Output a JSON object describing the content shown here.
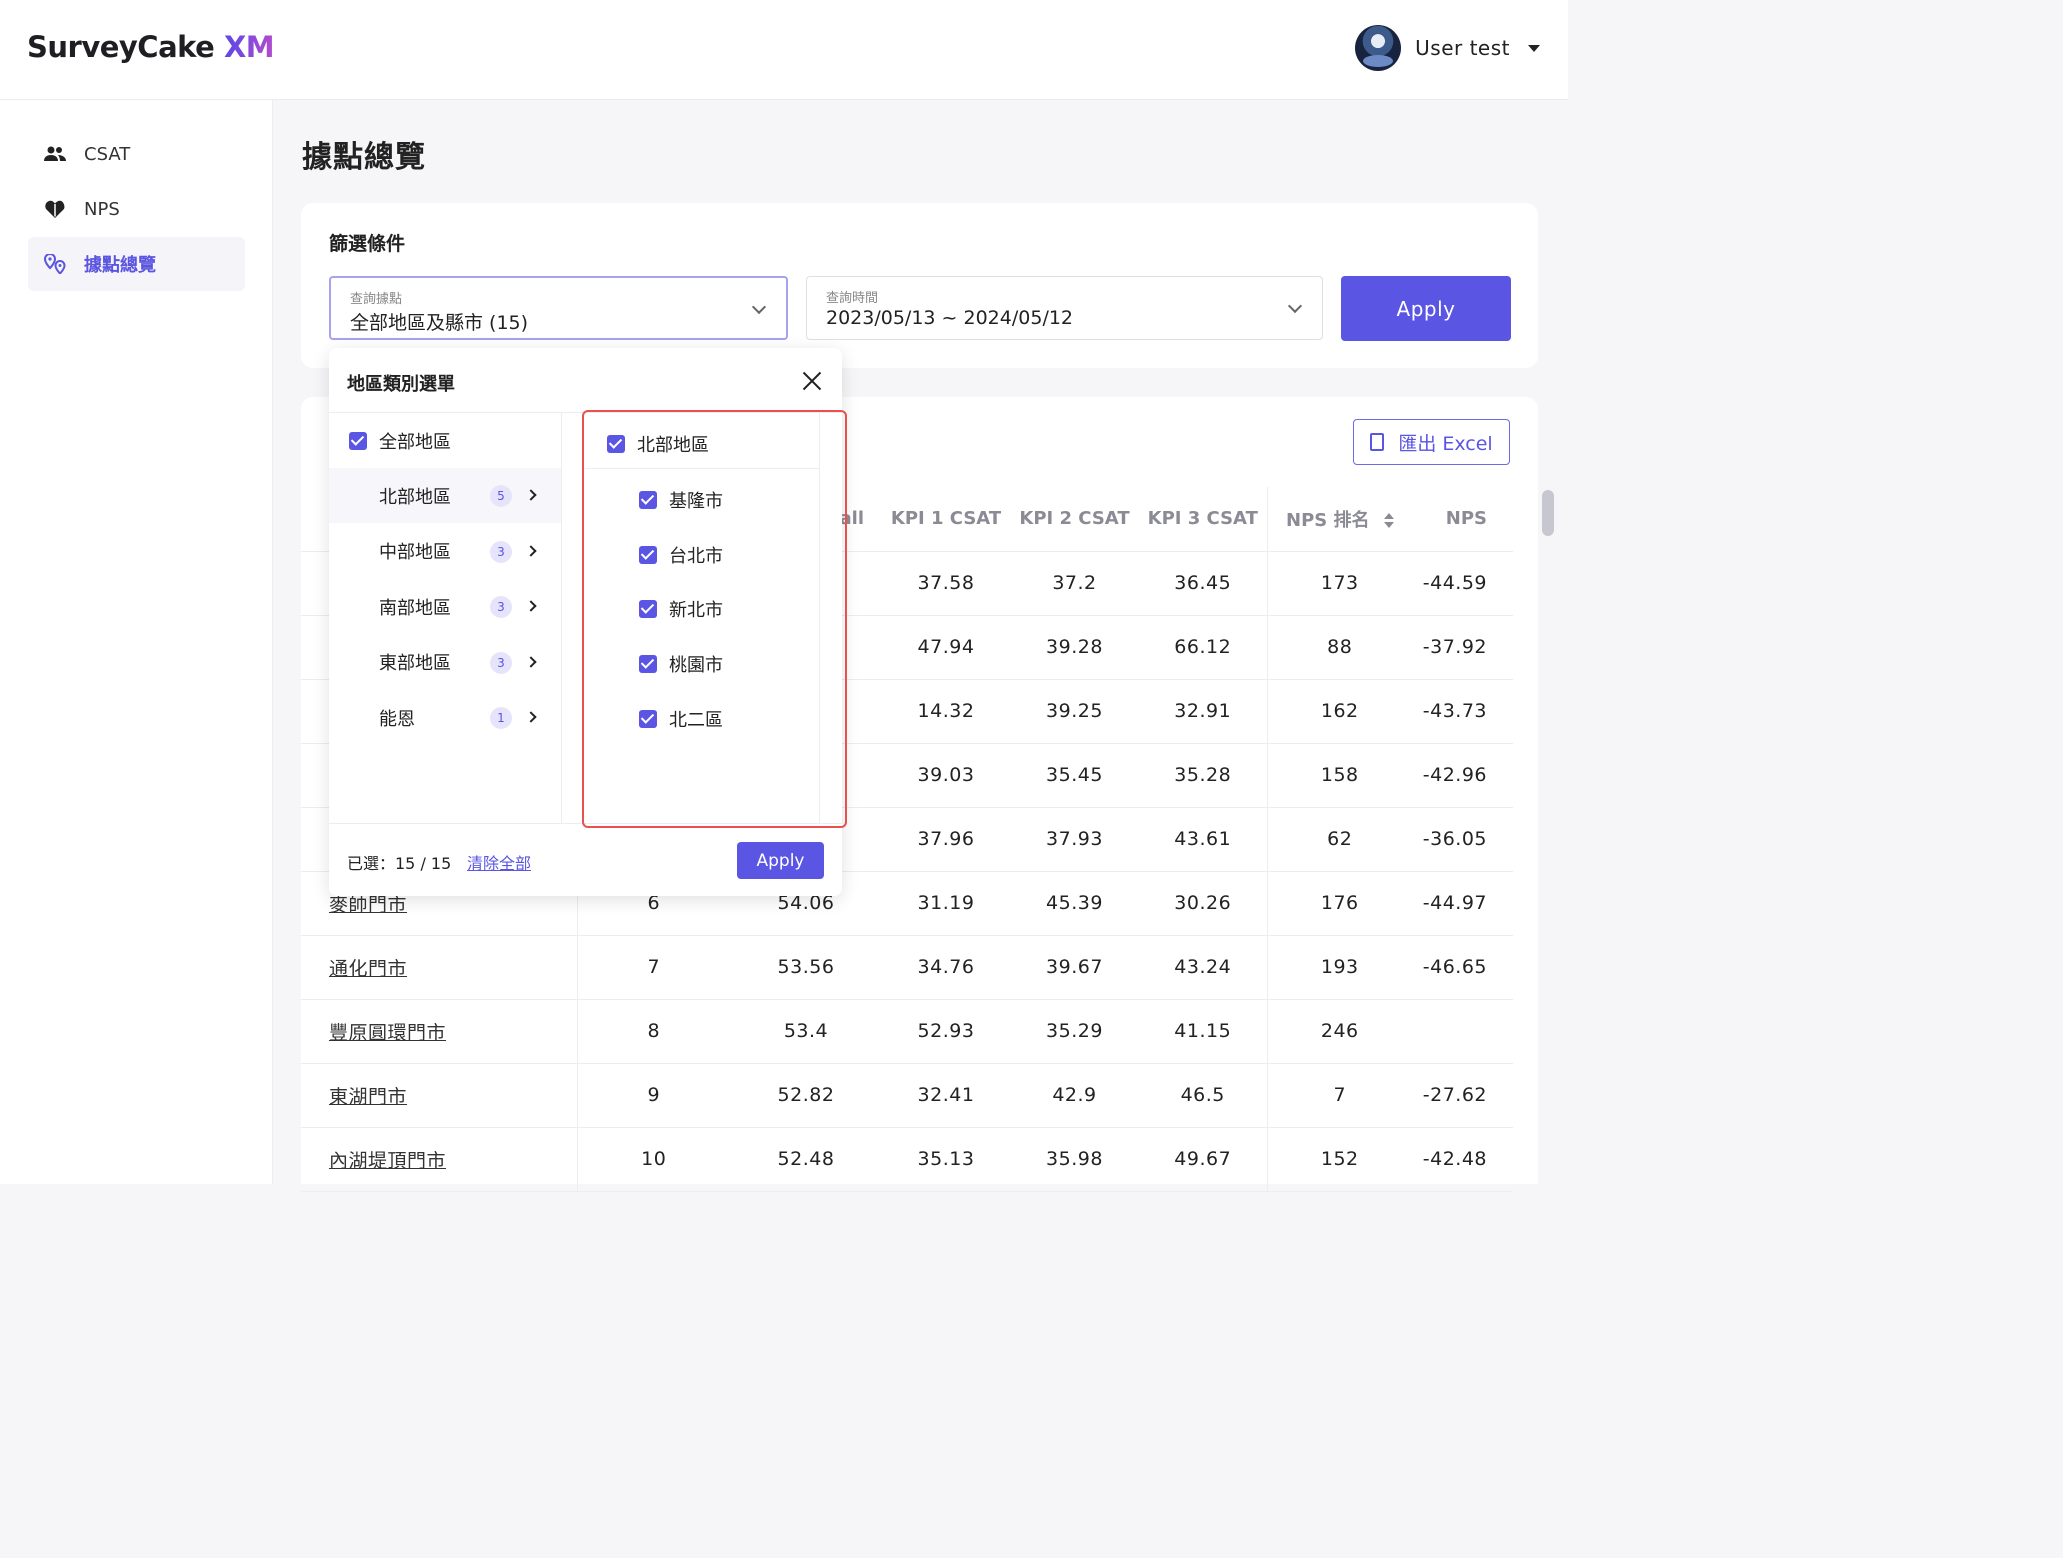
{
  "header": {
    "logo_main": "SurveyCake",
    "logo_xm": "XM",
    "user_name": "User test"
  },
  "sidebar": {
    "items": [
      {
        "label": "CSAT",
        "icon": "users-icon"
      },
      {
        "label": "NPS",
        "icon": "heart-icon"
      },
      {
        "label": "據點總覽",
        "icon": "location-pins-icon",
        "active": true
      }
    ]
  },
  "page": {
    "title": "據點總覽"
  },
  "filter": {
    "title": "篩選條件",
    "location": {
      "caption": "查詢據點",
      "value": "全部地區及縣市 (15)"
    },
    "date": {
      "caption": "查詢時間",
      "value": "2023/05/13 ~ 2024/05/12"
    },
    "apply_label": "Apply"
  },
  "export": {
    "label": "匯出 Excel"
  },
  "table": {
    "columns": {
      "partial": "all",
      "kpi1": "KPI 1 CSAT",
      "kpi2": "KPI 2 CSAT",
      "kpi3": "KPI 3 CSAT",
      "nps_rank": "NPS 排名",
      "nps": "NPS"
    },
    "rows": [
      {
        "name": "",
        "rank": "",
        "overall": "",
        "kpi1": "37.58",
        "kpi2": "37.2",
        "kpi3": "36.45",
        "nps_rank": "173",
        "nps": "-44.59"
      },
      {
        "name": "",
        "rank": "",
        "overall": "",
        "kpi1": "47.94",
        "kpi2": "39.28",
        "kpi3": "66.12",
        "nps_rank": "88",
        "nps": "-37.92"
      },
      {
        "name": "",
        "rank": "",
        "overall": "",
        "kpi1": "14.32",
        "kpi2": "39.25",
        "kpi3": "32.91",
        "nps_rank": "162",
        "nps": "-43.73"
      },
      {
        "name": "",
        "rank": "",
        "overall": "",
        "kpi1": "39.03",
        "kpi2": "35.45",
        "kpi3": "35.28",
        "nps_rank": "158",
        "nps": "-42.96"
      },
      {
        "name": "",
        "rank": "",
        "overall": "",
        "kpi1": "37.96",
        "kpi2": "37.93",
        "kpi3": "43.61",
        "nps_rank": "62",
        "nps": "-36.05"
      },
      {
        "name": "麥帥門市",
        "rank": "6",
        "overall": "54.06",
        "kpi1": "31.19",
        "kpi2": "45.39",
        "kpi3": "30.26",
        "nps_rank": "176",
        "nps": "-44.97"
      },
      {
        "name": "通化門市",
        "rank": "7",
        "overall": "53.56",
        "kpi1": "34.76",
        "kpi2": "39.67",
        "kpi3": "43.24",
        "nps_rank": "193",
        "nps": "-46.65"
      },
      {
        "name": "豐原圓環門市",
        "rank": "8",
        "overall": "53.4",
        "kpi1": "52.93",
        "kpi2": "35.29",
        "kpi3": "41.15",
        "nps_rank": "246",
        "nps": ""
      },
      {
        "name": "東湖門市",
        "rank": "9",
        "overall": "52.82",
        "kpi1": "32.41",
        "kpi2": "42.9",
        "kpi3": "46.5",
        "nps_rank": "7",
        "nps": "-27.62"
      },
      {
        "name": "內湖堤頂門市",
        "rank": "10",
        "overall": "52.48",
        "kpi1": "35.13",
        "kpi2": "35.98",
        "kpi3": "49.67",
        "nps_rank": "152",
        "nps": "-42.48"
      }
    ]
  },
  "dropdown": {
    "title": "地區類別選單",
    "all_label": "全部地區",
    "regions": [
      {
        "label": "北部地區",
        "count": "5"
      },
      {
        "label": "中部地區",
        "count": "3"
      },
      {
        "label": "南部地區",
        "count": "3"
      },
      {
        "label": "東部地區",
        "count": "3"
      },
      {
        "label": "能恩",
        "count": "1"
      }
    ],
    "selected_region": "北部地區",
    "cities": [
      "基隆市",
      "台北市",
      "新北市",
      "桃園市",
      "北二區"
    ],
    "footer_count": "已選：15 / 15",
    "clear_label": "清除全部",
    "apply_label": "Apply"
  }
}
